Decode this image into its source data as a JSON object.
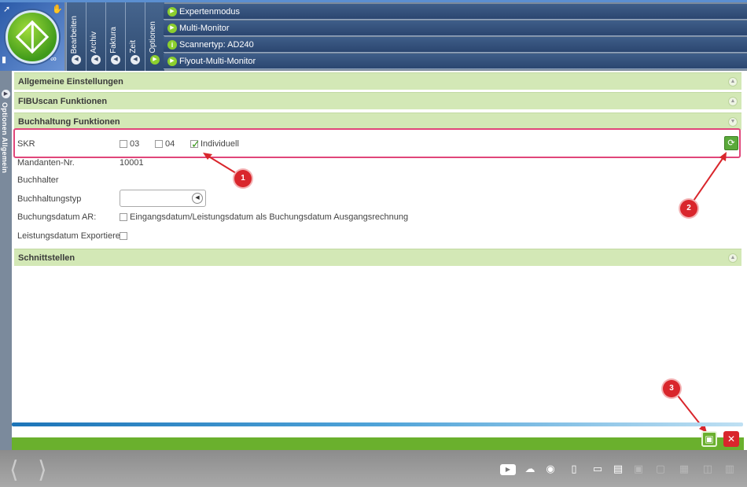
{
  "header": {
    "tabs": [
      {
        "label": "Bearbeiten",
        "active": false
      },
      {
        "label": "Archiv",
        "active": false
      },
      {
        "label": "Faktura",
        "active": false
      },
      {
        "label": "Zeit",
        "active": false
      },
      {
        "label": "Optionen",
        "active": true
      }
    ],
    "menu": [
      {
        "label": "Expertenmodus",
        "icon": "play-icon"
      },
      {
        "label": "Multi-Monitor",
        "icon": "play-icon"
      },
      {
        "label": "Scannertyp: AD240",
        "icon": "info-icon"
      },
      {
        "label": "Flyout-Multi-Monitor",
        "icon": "play-icon"
      }
    ]
  },
  "sidebar": {
    "label": "Optionen  Allgemein"
  },
  "sections": {
    "allgemeine": "Allgemeine Einstellungen",
    "fibuscan": "FIBUscan Funktionen",
    "buchhaltung": "Buchhaltung Funktionen",
    "schnittstellen": "Schnittstellen"
  },
  "form": {
    "skr": {
      "label": "SKR",
      "opt_03": "03",
      "opt_04": "04",
      "opt_ind": "Individuell",
      "selected": "Individuell"
    },
    "mandant": {
      "label": "Mandanten-Nr.",
      "value": "10001"
    },
    "buchhalter": {
      "label": "Buchhalter"
    },
    "buchhaltungstyp": {
      "label": "Buchhaltungstyp",
      "value": ""
    },
    "buchungsdatum": {
      "label": "Buchungsdatum AR:",
      "option": "Eingangsdatum/Leistungsdatum als Buchungsdatum Ausgangsrechnung"
    },
    "leistungsdatum": {
      "label": "Leistungsdatum Exportieren"
    }
  },
  "annotations": [
    "1",
    "2",
    "3"
  ],
  "colors": {
    "accent": "#6ab02d",
    "header": "#2b4670",
    "highlight": "#e0467a",
    "danger": "#d9262c"
  }
}
